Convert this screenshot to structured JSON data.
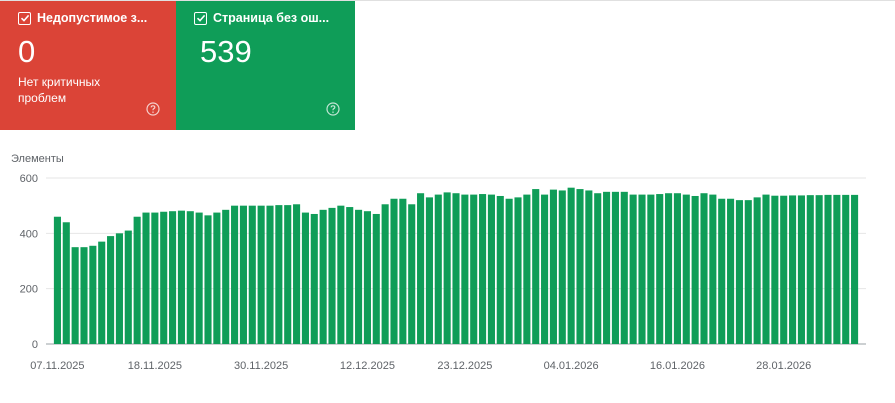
{
  "cards": {
    "invalid": {
      "title": "Недопустимое з...",
      "count": "0",
      "subtitle": "Нет критичных проблем",
      "color": "#db4437",
      "checkbox_icon": "checkbox-checked-icon",
      "help_icon": "help-circle-icon"
    },
    "valid": {
      "title": "Страница без ош...",
      "count": "539",
      "color": "#0f9d58",
      "checkbox_icon": "checkbox-checked-icon",
      "help_icon": "help-circle-icon"
    }
  },
  "chart_data": {
    "type": "bar",
    "ylabel": "Элементы",
    "ylim": [
      0,
      600
    ],
    "yticks": [
      0,
      200,
      400,
      600
    ],
    "grid": true,
    "bar_color": "#0f9d58",
    "x_tick_labels": [
      "07.11.2025",
      "18.11.2025",
      "30.11.2025",
      "12.12.2025",
      "23.12.2025",
      "04.01.2026",
      "16.01.2026",
      "28.01.2026"
    ],
    "x_tick_indices": [
      0,
      11,
      23,
      35,
      46,
      58,
      70,
      82
    ],
    "values": [
      460,
      440,
      350,
      350,
      355,
      370,
      390,
      400,
      410,
      460,
      475,
      475,
      478,
      480,
      482,
      480,
      475,
      465,
      475,
      485,
      500,
      500,
      500,
      500,
      500,
      502,
      502,
      505,
      475,
      470,
      485,
      492,
      500,
      495,
      485,
      480,
      470,
      505,
      525,
      525,
      505,
      545,
      530,
      540,
      548,
      545,
      540,
      540,
      542,
      540,
      535,
      525,
      530,
      540,
      560,
      540,
      558,
      555,
      565,
      560,
      555,
      545,
      550,
      550,
      550,
      540,
      540,
      540,
      542,
      545,
      545,
      540,
      535,
      545,
      540,
      525,
      525,
      520,
      520,
      530,
      540,
      536,
      536,
      537,
      537,
      538,
      538,
      539,
      539,
      539,
      539
    ]
  }
}
